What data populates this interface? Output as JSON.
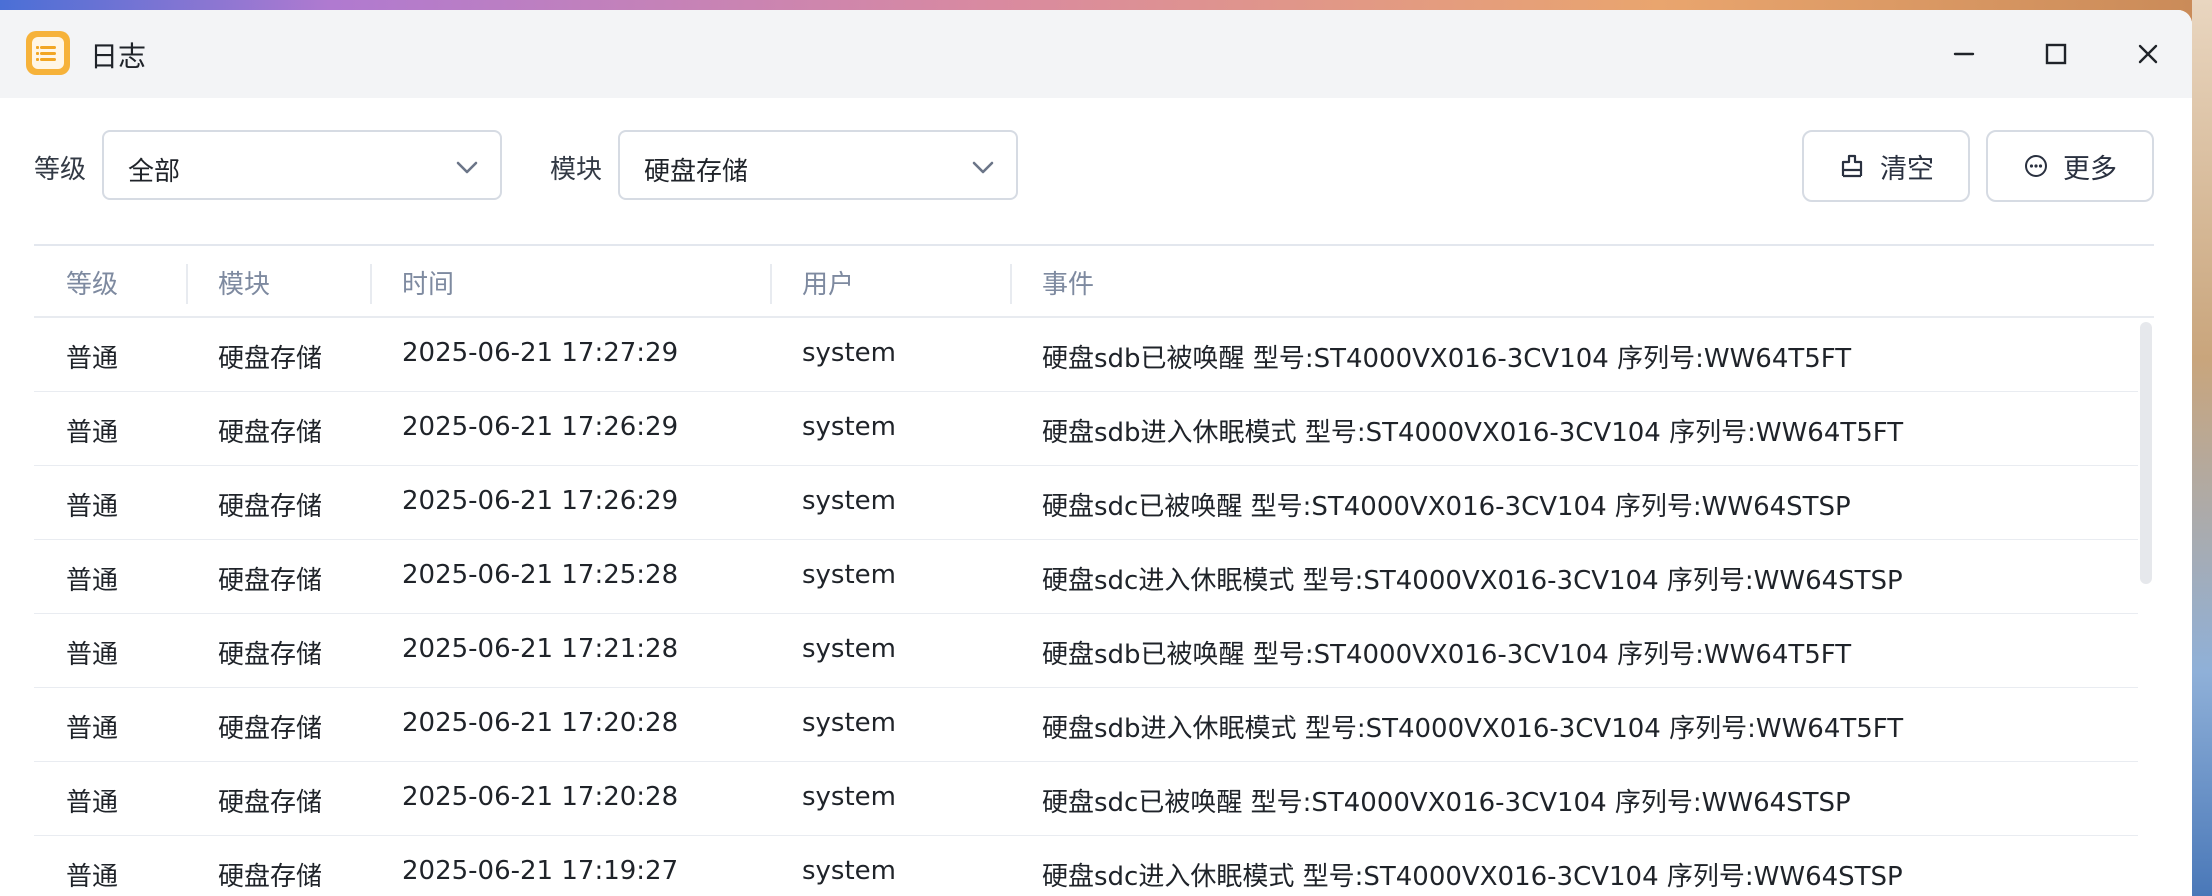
{
  "window": {
    "title": "日志"
  },
  "toolbar": {
    "level_label": "等级",
    "level_value": "全部",
    "module_label": "模块",
    "module_value": "硬盘存储",
    "clear_label": "清空",
    "more_label": "更多"
  },
  "table": {
    "headers": [
      "等级",
      "模块",
      "时间",
      "用户",
      "事件"
    ],
    "rows": [
      [
        "普通",
        "硬盘存储",
        "2025-06-21 17:27:29",
        "system",
        "硬盘sdb已被唤醒 型号:ST4000VX016-3CV104 序列号:WW64T5FT"
      ],
      [
        "普通",
        "硬盘存储",
        "2025-06-21 17:26:29",
        "system",
        "硬盘sdb进入休眠模式 型号:ST4000VX016-3CV104 序列号:WW64T5FT"
      ],
      [
        "普通",
        "硬盘存储",
        "2025-06-21 17:26:29",
        "system",
        "硬盘sdc已被唤醒 型号:ST4000VX016-3CV104 序列号:WW64STSP"
      ],
      [
        "普通",
        "硬盘存储",
        "2025-06-21 17:25:28",
        "system",
        "硬盘sdc进入休眠模式 型号:ST4000VX016-3CV104 序列号:WW64STSP"
      ],
      [
        "普通",
        "硬盘存储",
        "2025-06-21 17:21:28",
        "system",
        "硬盘sdb已被唤醒 型号:ST4000VX016-3CV104 序列号:WW64T5FT"
      ],
      [
        "普通",
        "硬盘存储",
        "2025-06-21 17:20:28",
        "system",
        "硬盘sdb进入休眠模式 型号:ST4000VX016-3CV104 序列号:WW64T5FT"
      ],
      [
        "普通",
        "硬盘存储",
        "2025-06-21 17:20:28",
        "system",
        "硬盘sdc已被唤醒 型号:ST4000VX016-3CV104 序列号:WW64STSP"
      ],
      [
        "普通",
        "硬盘存储",
        "2025-06-21 17:19:27",
        "system",
        "硬盘sdc进入休眠模式 型号:ST4000VX016-3CV104 序列号:WW64STSP"
      ]
    ]
  },
  "icons": {
    "app": "log-app-icon",
    "minimize": "minimize-icon",
    "maximize": "maximize-icon",
    "close": "close-icon",
    "dropdown": "chevron-down-icon",
    "clear": "broom-icon",
    "more": "more-dots-icon"
  }
}
